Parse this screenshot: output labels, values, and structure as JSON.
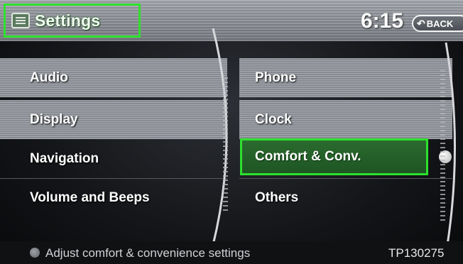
{
  "header": {
    "title": "Settings",
    "clock": "6:15",
    "back_label": "BACK"
  },
  "menu_left": [
    "Audio",
    "Display",
    "Navigation",
    "Volume and Beeps"
  ],
  "menu_right": [
    "Phone",
    "Clock",
    "Comfort & Conv.",
    "Others"
  ],
  "selected_item": "Comfort & Conv.",
  "status_bar": {
    "hint": "Adjust comfort & convenience settings"
  },
  "image_code": "TP130275",
  "colors": {
    "highlight_border": "#2ee02e",
    "highlight_fill": "#2a6b2e"
  },
  "icons": {
    "title": "settings-screen-icon",
    "back": "back-arrow-icon",
    "hint": "info-dot-icon"
  }
}
